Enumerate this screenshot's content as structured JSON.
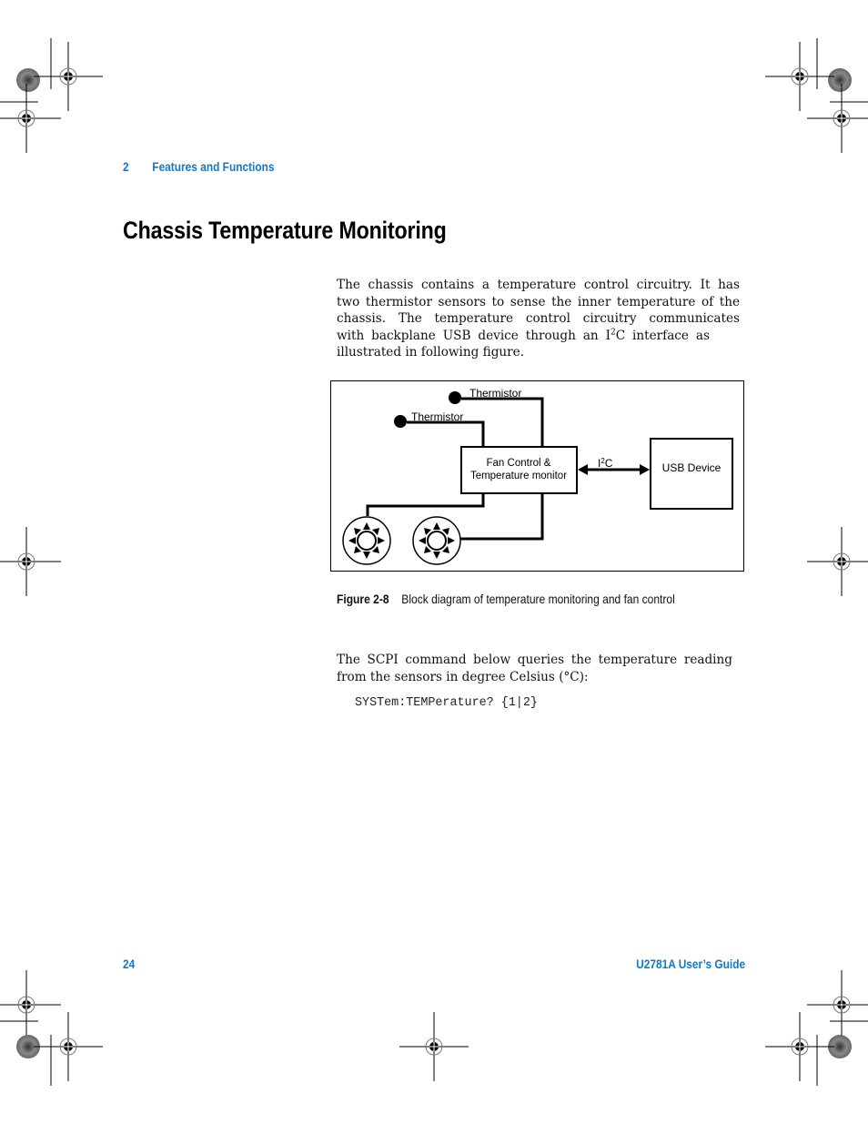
{
  "header": {
    "chapter_number": "2",
    "chapter_title": "Features and Functions"
  },
  "title": "Chassis Temperature Monitoring",
  "intro_paragraph": {
    "lines": [
      "The chassis contains a temperature control circuitry. It has",
      "two thermistor sensors to sense the inner temperature of the",
      "chassis. The temperature control circuitry communicates",
      "with backplane USB device through an I",
      "illustrated in following figure."
    ],
    "superscript": "2",
    "line4_tail": "C interface as"
  },
  "figure": {
    "thermistor_1_label": "Thermistor",
    "thermistor_2_label": "Thermistor",
    "controller_label_line1": "Fan Control &",
    "controller_label_line2": "Temperature monitor",
    "bus_label_base": "I",
    "bus_label_sup": "2",
    "bus_label_tail": "C",
    "usb_label": "USB Device",
    "caption_label": "Figure 2-8",
    "caption_text": "Block diagram of temperature monitoring and fan control"
  },
  "scpi_paragraph": {
    "lines": [
      "The SCPI command below queries the temperature reading",
      "from the sensors in degree Celsius (°C):"
    ]
  },
  "command": "SYSTem:TEMPerature? {1|2}",
  "footer": {
    "page_number": "24",
    "guide_title": "U2781A User’s Guide"
  }
}
